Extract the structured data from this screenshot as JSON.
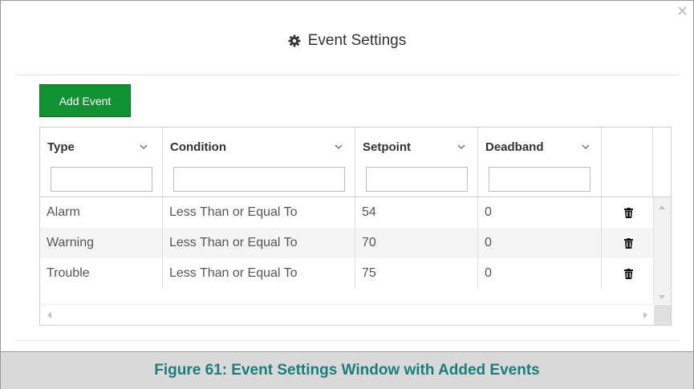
{
  "dialog": {
    "title": "Event Settings",
    "title_icon": "gear-icon",
    "close_glyph": "×"
  },
  "toolbar": {
    "add_label": "Add Event",
    "add_color": "#119232"
  },
  "table": {
    "columns": [
      {
        "label": "Type",
        "filter_value": ""
      },
      {
        "label": "Condition",
        "filter_value": ""
      },
      {
        "label": "Setpoint",
        "filter_value": ""
      },
      {
        "label": "Deadband",
        "filter_value": ""
      },
      {
        "label": ""
      }
    ],
    "rows": [
      {
        "type": "Alarm",
        "condition": "Less Than or Equal To",
        "setpoint": "54",
        "deadband": "0",
        "action_icon": "trash-icon"
      },
      {
        "type": "Warning",
        "condition": "Less Than or Equal To",
        "setpoint": "70",
        "deadband": "0",
        "action_icon": "trash-icon"
      },
      {
        "type": "Trouble",
        "condition": "Less Than or Equal To",
        "setpoint": "75",
        "deadband": "0",
        "action_icon": "trash-icon"
      }
    ]
  },
  "caption": {
    "text": "Figure 61: Event Settings Window with Added Events",
    "color": "#1a7f7a"
  }
}
